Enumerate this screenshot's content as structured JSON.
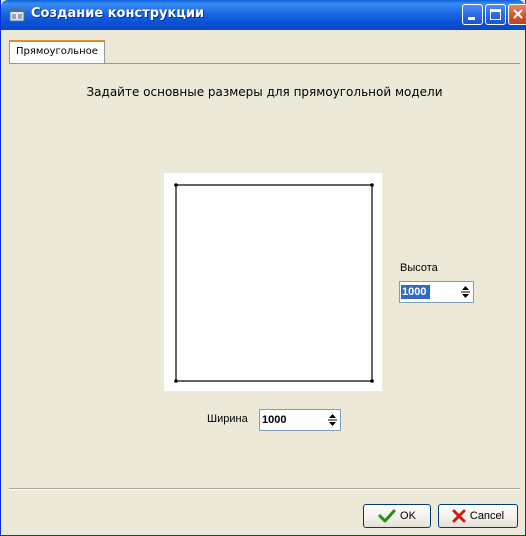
{
  "window": {
    "title": "Создание конструкции"
  },
  "tabs": [
    {
      "label": "Прямоугольное",
      "active": true
    }
  ],
  "main": {
    "instruction": "Задайте основные размеры для прямоугольной модели",
    "height": {
      "label": "Высота",
      "value": "1000"
    },
    "width": {
      "label": "Ширина",
      "value": "1000"
    }
  },
  "footer": {
    "ok_label": "OK",
    "cancel_label": "Cancel"
  },
  "colors": {
    "titlebar": "#0a54d8",
    "dialog_bg": "#ece9d8",
    "selection": "#316ac5",
    "ok_check": "#2a8a1a",
    "cancel_x": "#d01a10",
    "tab_accent": "#e68b2c"
  }
}
